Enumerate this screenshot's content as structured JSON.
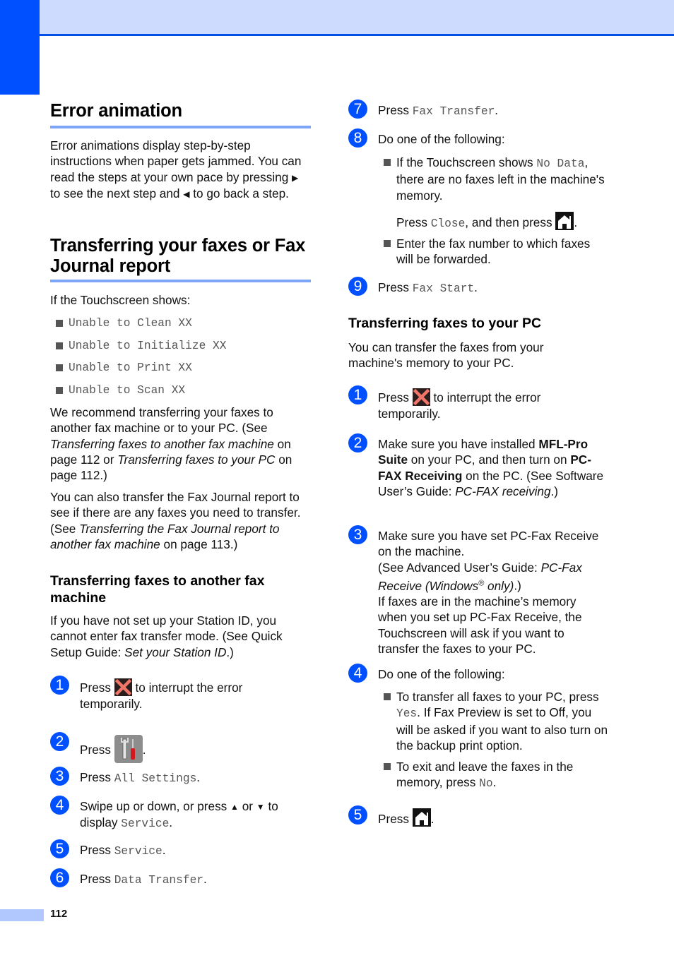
{
  "page_number": "112",
  "left": {
    "error_animation": {
      "title": "Error animation",
      "para": {
        "t1": "Error animations display step-by-step instructions when paper gets jammed. You can read the steps at your own pace by pressing ",
        "right_arrow": "▶",
        "t2": " to see the next step and ",
        "left_arrow": "◀",
        "t3": " to go back a step."
      }
    },
    "transfer": {
      "title": "Transferring your faxes or Fax Journal report",
      "intro": "If the Touchscreen shows:",
      "messages": [
        "Unable to Clean XX",
        "Unable to Initialize XX",
        "Unable to Print XX",
        "Unable to Scan XX"
      ],
      "para1": {
        "t1": "We recommend transferring your faxes to another fax machine or to your PC. (See ",
        "i1": "Transferring faxes to another fax machine",
        "t2": " on page 112 or ",
        "i2": "Transferring faxes to your PC",
        "t3": " on page 112.)"
      },
      "para2": {
        "t1": "You can also transfer the Fax Journal report to see if there are any faxes you need to transfer. (See ",
        "i1": "Transferring the Fax Journal report to another fax machine",
        "t2": " on page 113.)"
      }
    },
    "another_fax": {
      "title": "Transferring faxes to another fax machine",
      "para": {
        "t1": "If you have not set up your Station ID, you cannot enter fax transfer mode. (See Quick Setup Guide: ",
        "i1": "Set your Station ID",
        "t2": ".)"
      },
      "steps": [
        {
          "num": "1",
          "pre": "Press ",
          "icon": "cancel-x-icon",
          "post": " to interrupt the error temporarily."
        },
        {
          "num": "2",
          "pre": "Press ",
          "icon": "settings-tools-icon",
          "post": "."
        },
        {
          "num": "3",
          "pre": "Press ",
          "code": "All Settings",
          "post": "."
        },
        {
          "num": "4",
          "pre": "Swipe up or down, or press ",
          "up": "▲",
          "mid": " or ",
          "down": "▼",
          "post1": " to display ",
          "code": "Service",
          "post": "."
        },
        {
          "num": "5",
          "pre": "Press ",
          "code": "Service",
          "post": "."
        },
        {
          "num": "6",
          "pre": "Press ",
          "code": "Data Transfer",
          "post": "."
        }
      ]
    }
  },
  "right": {
    "steps_cont": [
      {
        "num": "7",
        "pre": "Press ",
        "code": "Fax Transfer",
        "post": "."
      },
      {
        "num": "8",
        "text": "Do one of the following:",
        "bullets": [
          {
            "pre": "If the Touchscreen shows ",
            "code": "No Data",
            "post": ", there are no faxes left in the machine's memory.",
            "sub_pre": "Press ",
            "sub_code": "Close",
            "sub_mid": ", and then press ",
            "sub_icon": "home-icon",
            "sub_post": "."
          },
          {
            "text": "Enter the fax number to which faxes will be forwarded."
          }
        ]
      },
      {
        "num": "9",
        "pre": "Press ",
        "code": "Fax Start",
        "post": "."
      }
    ],
    "to_pc": {
      "title": "Transferring faxes to your PC",
      "intro": "You can transfer the faxes from your machine's memory to your PC.",
      "steps": [
        {
          "num": "1",
          "pre": "Press ",
          "icon": "cancel-x-icon",
          "post": " to interrupt the error temporarily."
        },
        {
          "num": "2",
          "t1": "Make sure you have installed ",
          "b1": "MFL-Pro Suite",
          "t2": " on your PC, and then turn on ",
          "b2": "PC-FAX Receiving",
          "t3": " on the PC. (See Software User’s Guide: ",
          "i1": "PC-FAX receiving",
          "t4": ".)"
        },
        {
          "num": "3",
          "t1": "Make sure you have set PC-Fax Receive on the machine.",
          "t2": "(See Advanced User’s Guide: ",
          "i1": "PC-Fax Receive (Windows",
          "sup": "®",
          "i2": " only)",
          "t3": ".)",
          "t4": "If faxes are in the machine’s memory when you set up PC-Fax Receive, the Touchscreen will ask if you want to transfer the faxes to your PC."
        },
        {
          "num": "4",
          "text": "Do one of the following:",
          "bullets": [
            {
              "pre": "To transfer all faxes to your PC, press ",
              "code": "Yes",
              "post": ". If Fax Preview is set to Off, you will be asked if you want to also turn on the backup print option."
            },
            {
              "pre": "To exit and leave the faxes in the memory, press ",
              "code": "No",
              "post": "."
            }
          ]
        },
        {
          "num": "5",
          "pre": "Press ",
          "icon": "home-icon",
          "post": "."
        }
      ]
    }
  },
  "colors": {
    "accent_blue": "#0050ff",
    "header_band": "#cddcfe",
    "rule_blue": "#7ea6f8",
    "footer_bar": "#b0c8fd"
  }
}
